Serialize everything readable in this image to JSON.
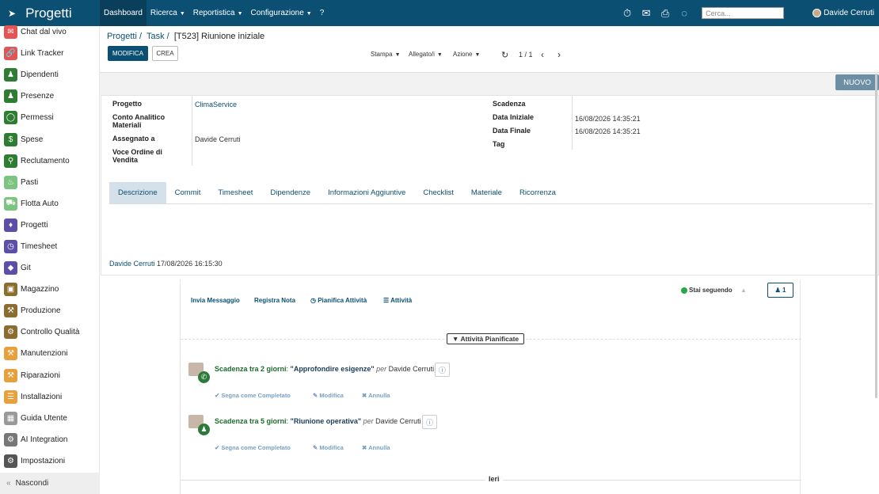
{
  "topbar": {
    "app_title": "Progetti",
    "menu": [
      {
        "label": "Dashboard",
        "active": true,
        "dropdown": false
      },
      {
        "label": "Ricerca",
        "dropdown": true
      },
      {
        "label": "Reportistica",
        "dropdown": true
      },
      {
        "label": "Configurazione",
        "dropdown": true
      },
      {
        "label": "?",
        "dropdown": false
      }
    ],
    "search_placeholder": "Cerca...",
    "user_name": "Davide Cerruti"
  },
  "sidebar": {
    "items": [
      {
        "label": "Chat dal vivo",
        "icon": "chat-icon",
        "color": "#e35454"
      },
      {
        "label": "Link Tracker",
        "icon": "link-icon",
        "color": "#e35454"
      },
      {
        "label": "Dipendenti",
        "icon": "users-icon",
        "color": "#2e7d32"
      },
      {
        "label": "Presenze",
        "icon": "user-check-icon",
        "color": "#2e7d32"
      },
      {
        "label": "Permessi",
        "icon": "circle-icon",
        "color": "#2e7d32"
      },
      {
        "label": "Spese",
        "icon": "dollar-icon",
        "color": "#2e7d32"
      },
      {
        "label": "Reclutamento",
        "icon": "search-user-icon",
        "color": "#2e7d32"
      },
      {
        "label": "Pasti",
        "icon": "cutlery-icon",
        "color": "#7cc47f"
      },
      {
        "label": "Flotta Auto",
        "icon": "car-icon",
        "color": "#7cc47f"
      },
      {
        "label": "Progetti",
        "icon": "puzzle-icon",
        "color": "#5b4fa8"
      },
      {
        "label": "Timesheet",
        "icon": "clock-icon",
        "color": "#5b4fa8"
      },
      {
        "label": "Git",
        "icon": "git-icon",
        "color": "#5b4fa8"
      },
      {
        "label": "Magazzino",
        "icon": "box-icon",
        "color": "#8a6d2f"
      },
      {
        "label": "Produzione",
        "icon": "wrench-icon",
        "color": "#8a6d2f"
      },
      {
        "label": "Controllo Qualità",
        "icon": "quality-icon",
        "color": "#8a6d2f"
      },
      {
        "label": "Manutenzioni",
        "icon": "hammer-icon",
        "color": "#e8a03c"
      },
      {
        "label": "Riparazioni",
        "icon": "repair-icon",
        "color": "#e8a03c"
      },
      {
        "label": "Installazioni",
        "icon": "install-icon",
        "color": "#e8a03c"
      },
      {
        "label": "Guida Utente",
        "icon": "guide-icon",
        "color": "#999999"
      },
      {
        "label": "AI Integration",
        "icon": "ai-icon",
        "color": "#777777"
      },
      {
        "label": "Impostazioni",
        "icon": "gear-icon",
        "color": "#555555"
      }
    ],
    "hide_label": "Nascondi"
  },
  "breadcrumb": {
    "part1": "Progetti",
    "part2": "Task",
    "current": "[T523] Riunione iniziale"
  },
  "actions": {
    "edit": "MODIFICA",
    "create": "CREA",
    "print": "Stampa",
    "attach": "Allegato/i",
    "action": "Azione",
    "pager": "1 / 1",
    "new": "NUOVO"
  },
  "form": {
    "project_label": "Progetto",
    "project_value": "ClimaService",
    "analytic_label": "Conto Analitico Materiali",
    "assigned_label": "Assegnato a",
    "assigned_value": "Davide Cerruti",
    "sale_label": "Voce Ordine di Vendita",
    "deadline_label": "Scadenza",
    "start_label": "Data Iniziale",
    "start_value": "16/08/2026 14:35:21",
    "end_label": "Data Finale",
    "end_value": "16/08/2026 14:35:21",
    "tag_label": "Tag"
  },
  "tabs": [
    "Descrizione",
    "Commit",
    "Timesheet",
    "Dipendenze",
    "Informazioni Aggiuntive",
    "Checklist",
    "Materiale",
    "Ricorrenza"
  ],
  "description_footer": {
    "author": "Davide Cerruti",
    "date": "17/08/2026 16:15:30"
  },
  "chatter": {
    "send_message": "Invia Messaggio",
    "log_note": "Registra Nota",
    "schedule": "Pianifica Attività",
    "activities": "Attività",
    "following": "Stai seguendo",
    "followers_count": "1",
    "planned_label": "Attività Pianificate",
    "activity_list": [
      {
        "due": "Scadenza tra 2 giorni",
        "summary": "\"Approfondire esigenze\"",
        "by": "per",
        "user": "Davide Cerruti",
        "badge_icon": "phone-icon"
      },
      {
        "due": "Scadenza tra 5 giorni",
        "summary": "\"Riunione operativa\"",
        "by": "per",
        "user": "Davide Cerruti",
        "badge_icon": "users-icon"
      }
    ],
    "mark_done": "Segna come Completato",
    "edit": "Modifica",
    "cancel": "Annulla",
    "yesterday": "Ieri"
  }
}
